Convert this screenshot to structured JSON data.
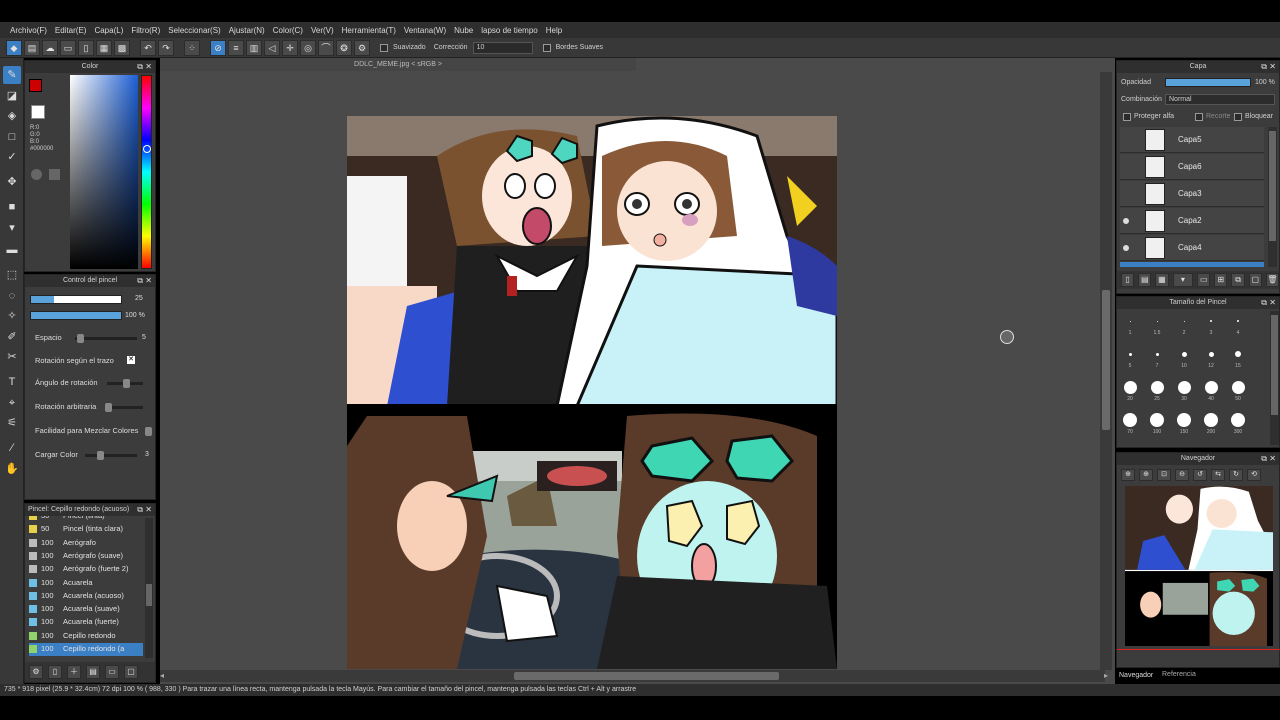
{
  "menu": [
    "Archivo(F)",
    "Editar(E)",
    "Capa(L)",
    "Filtro(R)",
    "Seleccionar(S)",
    "Ajustar(N)",
    "Color(C)",
    "Ver(V)",
    "Herramienta(T)",
    "Ventana(W)",
    "Nube",
    "lapso de tiempo",
    "Help"
  ],
  "toolbar": {
    "smoothing_label": "Suavizado",
    "correction_label": "Corrección",
    "correction_value": "10",
    "soft_edges_label": "Bordes Suaves"
  },
  "color_panel": {
    "title": "Color",
    "rgb_r": "R:0",
    "rgb_g": "G:0",
    "rgb_b": "B:0",
    "hex": "#000000",
    "fg_color": "#cc0000",
    "bg_color": "#ffffff"
  },
  "brush_control": {
    "title": "Control del pincel",
    "size_value": "25",
    "size_fraction": 0.25,
    "opacity_value": "100 %",
    "opacity_fraction": 1.0,
    "rows": [
      {
        "label": "Espacio",
        "value": "5"
      },
      {
        "label": "Rotación según el trazo",
        "value": ""
      },
      {
        "label": "Ángulo de rotación",
        "value": ""
      },
      {
        "label": "Rotación arbitraria",
        "value": ""
      },
      {
        "label": "Facilidad para Mezclar Colores",
        "value": ""
      },
      {
        "label": "Cargar Color",
        "value": "3"
      }
    ]
  },
  "brush_list": {
    "title": "Pincel: Cepillo redondo (acuoso)",
    "items": [
      {
        "size": "50",
        "name": "Pincel (tinta)",
        "color": "#e8d04a"
      },
      {
        "size": "50",
        "name": "Pincel (tinta clara)",
        "color": "#e8d04a"
      },
      {
        "size": "100",
        "name": "Aerógrafo",
        "color": "#bbbbbb"
      },
      {
        "size": "100",
        "name": "Aerógrafo (suave)",
        "color": "#bbbbbb"
      },
      {
        "size": "100",
        "name": "Aerógrafo (fuerte 2)",
        "color": "#bbbbbb"
      },
      {
        "size": "100",
        "name": "Acuarela",
        "color": "#6fc0e6"
      },
      {
        "size": "100",
        "name": "Acuarela (acuoso)",
        "color": "#6fc0e6"
      },
      {
        "size": "100",
        "name": "Acuarela (suave)",
        "color": "#6fc0e6"
      },
      {
        "size": "100",
        "name": "Acuarela (fuerte)",
        "color": "#6fc0e6"
      },
      {
        "size": "100",
        "name": "Cepillo redondo",
        "color": "#8fd36a"
      },
      {
        "size": "100",
        "name": "Cepillo redondo (a",
        "color": "#8fd36a"
      }
    ]
  },
  "document": {
    "tab_title": "DDLC_MEME.jpg < sRGB >"
  },
  "layer_panel": {
    "title": "Capa",
    "opacity_label": "Opacidad",
    "opacity_value": "100 %",
    "blend_label": "Combinación",
    "blend_value": "Normal",
    "protect_alpha": "Proteger alfa",
    "clip": "Recorte",
    "lock": "Bloquear",
    "layers": [
      {
        "name": "Capa5",
        "visible": false
      },
      {
        "name": "Capa6",
        "visible": false
      },
      {
        "name": "Capa3",
        "visible": false
      },
      {
        "name": "Capa2",
        "visible": true
      },
      {
        "name": "Capa4",
        "visible": true
      }
    ]
  },
  "brush_size_panel": {
    "title": "Tamaño del Pincel",
    "sizes": [
      "1",
      "1.5",
      "2",
      "3",
      "4",
      "5",
      "7",
      "10",
      "12",
      "15",
      "20",
      "25",
      "30",
      "40",
      "50",
      "70",
      "100",
      "150",
      "200",
      "300"
    ]
  },
  "navigator": {
    "title": "Navegador",
    "tab_nav": "Navegador",
    "tab_ref": "Referencia"
  },
  "status": {
    "text": "735 * 918 pixel  (25.9 * 32.4cm)  72 dpi  100 %  ( 988, 330 )  Para trazar una línea recta, mantenga pulsada la tecla Mayús. Para cambiar el tamaño del pincel, mantenga pulsada las teclas Ctrl + Alt y arrastre"
  }
}
